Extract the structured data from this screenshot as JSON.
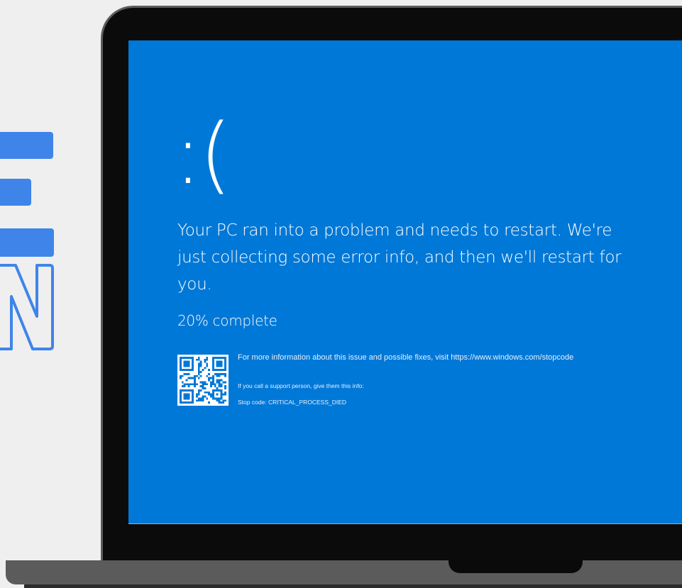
{
  "bsod": {
    "sad_face": ":(",
    "message": "Your PC ran into a problem and needs to restart. We're just collecting some error info, and then we'll restart for you.",
    "progress_text": "20% complete",
    "progress_percent": 20,
    "more_info_text": "For more information about this issue and possible fixes, visit https://www.windows.com/stopcode",
    "support_text": "If you call a support person, give them this info:",
    "stop_code_text": "Stop code: CRITICAL_PROCESS_DIED"
  },
  "colors": {
    "screen_background": "#0078d7",
    "text": "#ffffff",
    "logo_accent": "#3f85e9",
    "laptop_bezel": "#0b0b0b",
    "laptop_base": "#5b5b5b",
    "page_background": "#efefef"
  },
  "icons": {
    "qr_code": "qr-code-icon",
    "logo": "brand-logo-icon"
  }
}
